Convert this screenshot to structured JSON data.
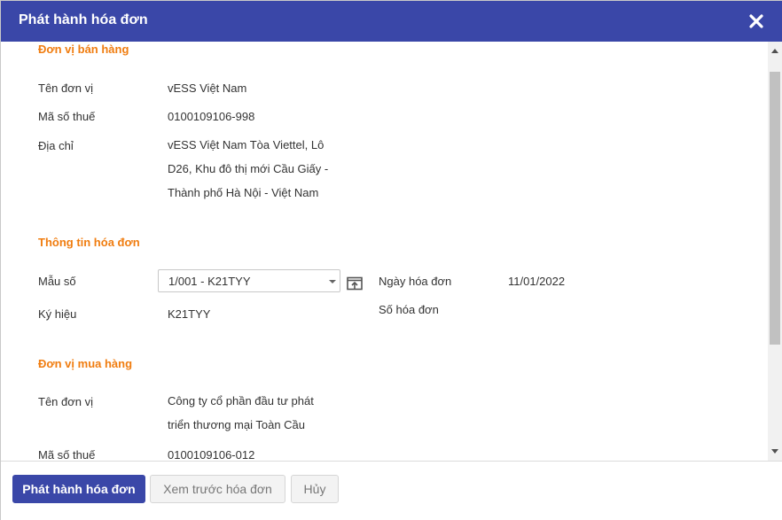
{
  "dialog": {
    "title": "Phát hành hóa đơn"
  },
  "seller": {
    "section_title": "Đơn vị bán hàng",
    "name_label": "Tên đơn vị",
    "name_value": "vESS Việt Nam",
    "tax_label": "Mã số thuế",
    "tax_value": "0100109106-998",
    "address_label": "Địa chỉ",
    "address_lines": [
      "vESS Việt Nam Tòa Viettel, Lô",
      "D26, Khu đô thị mới Cầu Giấy -",
      "Thành phố Hà Nội - Việt Nam"
    ]
  },
  "invoice": {
    "section_title": "Thông tin hóa đơn",
    "template_label": "Mẫu số",
    "template_value": "1/001 - K21TYY",
    "symbol_label": "Ký hiệu",
    "symbol_value": "K21TYY",
    "date_label": "Ngày hóa đơn",
    "date_value": "11/01/2022",
    "number_label": "Số hóa đơn"
  },
  "buyer": {
    "section_title": "Đơn vị mua hàng",
    "name_label": "Tên đơn vị",
    "name_lines": [
      "Công ty cổ phần đầu tư phát",
      "triển thương mại Toàn Cầu"
    ],
    "tax_label": "Mã số thuế",
    "tax_value": "0100109106-012"
  },
  "footer": {
    "publish_label": "Phát hành hóa đơn",
    "preview_label": "Xem trước hóa đơn",
    "cancel_label": "Hủy"
  },
  "colors": {
    "header_bg": "#3a47a8",
    "section_accent": "#f07d10"
  },
  "icons": {
    "close": "close-icon",
    "picker": "open-picker-icon"
  }
}
